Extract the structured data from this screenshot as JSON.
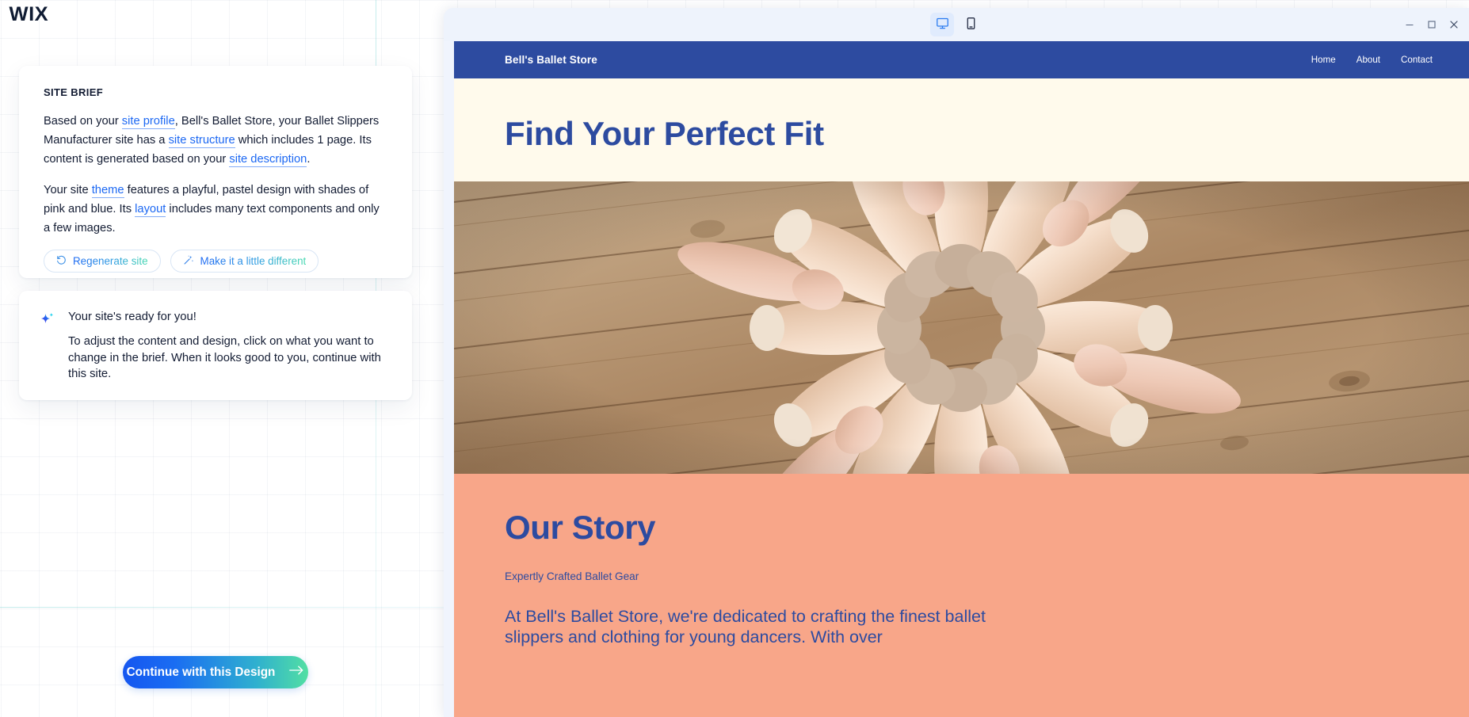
{
  "workspace": {
    "logo": "WIX",
    "continue_button": {
      "label": "Continue with this Design",
      "icon": "arrow-right-icon"
    }
  },
  "brief_card": {
    "title": "SITE BRIEF",
    "paragraph1": {
      "seg1": "Based on your ",
      "link1": "site profile",
      "seg2": ", Bell's Ballet Store, your Ballet Slippers Manufacturer site has a ",
      "link2": "site structure",
      "seg3": " which includes 1 page. Its content is generated based on your ",
      "link3": "site description",
      "seg4": "."
    },
    "paragraph2": {
      "seg1": "Your site ",
      "link1": "theme",
      "seg2": " features a playful, pastel design with shades of pink and blue. Its ",
      "link2": "layout",
      "seg3": " includes many text components and only a few images."
    },
    "buttons": [
      {
        "label": "Regenerate site",
        "icon": "refresh-icon"
      },
      {
        "label": "Make it a little different",
        "icon": "magic-wand-icon"
      }
    ]
  },
  "ready_card": {
    "icon": "sparkle-icon",
    "title": "Your site's ready for you!",
    "body": "To adjust the content and design, click on what you want to change in the brief. When it looks good to you, continue with this site."
  },
  "preview": {
    "devices": [
      {
        "name": "desktop",
        "icon": "monitor-icon",
        "active": true
      },
      {
        "name": "mobile",
        "icon": "phone-icon",
        "active": false
      }
    ],
    "window_controls": [
      {
        "name": "minimize",
        "icon": "minimize-icon"
      },
      {
        "name": "maximize",
        "icon": "maximize-icon"
      },
      {
        "name": "close",
        "icon": "close-icon"
      }
    ]
  },
  "site": {
    "brand": "Bell's Ballet Store",
    "nav": [
      "Home",
      "About",
      "Contact"
    ],
    "hero_heading": "Find Your Perfect Fit",
    "hero_image_alt": "ballet-pointe-shoes-circle-on-wooden-floor",
    "story": {
      "heading": "Our Story",
      "subheading": "Expertly Crafted Ballet Gear",
      "paragraph": "At Bell's Ballet Store, we're dedicated to crafting the finest ballet slippers and clothing for young dancers. With over"
    }
  },
  "colors": {
    "brand_blue": "#2d4ba0",
    "hero_bg": "#fffaec",
    "story_bg": "#f8a689",
    "link_blue": "#1c68f3",
    "accent_green": "#46d9b0"
  }
}
